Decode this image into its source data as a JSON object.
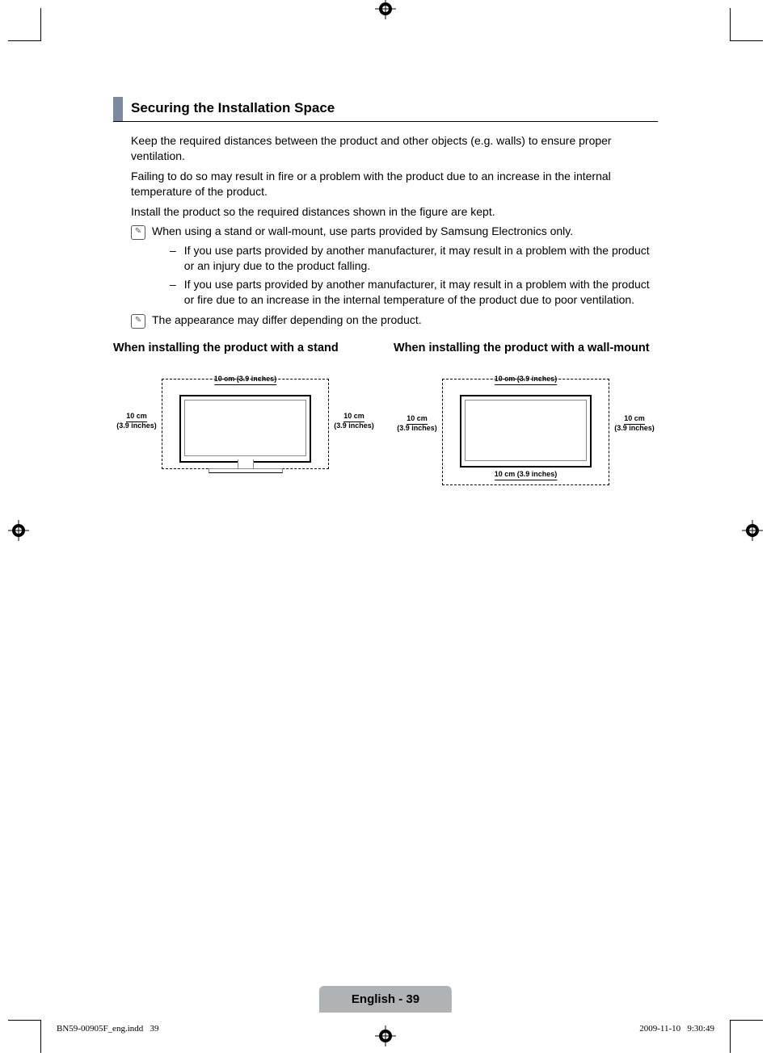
{
  "section": {
    "title": "Securing the Installation Space",
    "p1": "Keep the required distances between the product and other objects (e.g. walls) to ensure proper ventilation.",
    "p2": "Failing to do so may result in fire or a problem with the product due to an increase in the internal temperature of the product.",
    "p3": "Install the product so the required distances shown in the figure are kept.",
    "note1": "When using a stand or wall-mount, use parts provided by Samsung Electronics only.",
    "dash1": "If you use parts provided by another manufacturer, it may result in a problem with the product or an injury due to the product falling.",
    "dash2": "If you use parts provided by another manufacturer, it may result in a problem with the product or fire due to an increase in the internal temperature of the product due to poor ventilation.",
    "note2": "The appearance may differ depending on the product."
  },
  "diagrams": {
    "stand_title": "When installing the product with a stand",
    "wall_title": "When installing the product with a wall-mount",
    "dim_top": "10 cm (3.9 inches)",
    "dim_side_cm": "10 cm",
    "dim_side_in": "(3.9 inches)",
    "dim_bottom": "10 cm (3.9 inches)"
  },
  "footer": {
    "tab": "English - 39",
    "left_file": "BN59-00905F_eng.indd",
    "left_page": "39",
    "right_date": "2009-11-10",
    "right_time": "9:30:49"
  },
  "icons": {
    "note_glyph": "✎"
  }
}
